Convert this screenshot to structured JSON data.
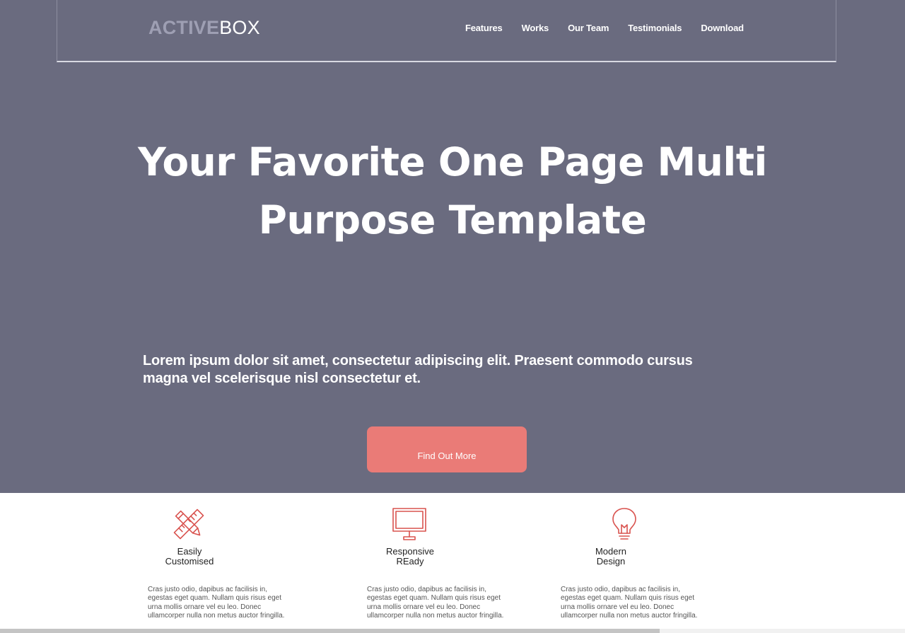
{
  "brand": {
    "logo_bold": "ACTIVE",
    "logo_light": "BOX"
  },
  "nav": {
    "items": [
      {
        "label": "Features"
      },
      {
        "label": "Works"
      },
      {
        "label": "Our Team"
      },
      {
        "label": "Testimonials"
      },
      {
        "label": "Download"
      }
    ]
  },
  "hero": {
    "headline_line1": "Your Favorite One Page Multi",
    "headline_line2": "Purpose Template",
    "lead": "Lorem ipsum dolor sit amet, consectetur adipiscing elit. Praesent commodo cursus magna vel scelerisque nisl consectetur et.",
    "cta_label": "Find Out More"
  },
  "features": [
    {
      "icon": "pencil-ruler-icon",
      "title_line1": "Easily",
      "title_line2": "Customised",
      "body": "Cras justo odio, dapibus ac facilisis in, egestas eget quam. Nullam quis risus eget urna mollis ornare vel eu leo. Donec ullamcorper nulla non metus auctor fringilla."
    },
    {
      "icon": "monitor-icon",
      "title_line1": "Responsive",
      "title_line2": "REady",
      "body": "Cras justo odio, dapibus ac facilisis in, egestas eget quam. Nullam quis risus eget urna mollis ornare vel eu leo. Donec ullamcorper nulla non metus auctor fringilla."
    },
    {
      "icon": "lightbulb-icon",
      "title_line1": "Modern",
      "title_line2": "Design",
      "body": "Cras justo odio, dapibus ac facilisis in, egestas eget quam. Nullam quis risus eget urna mollis ornare vel eu leo. Donec ullamcorper nulla non metus auctor fringilla."
    }
  ],
  "colors": {
    "hero_background": "#6a6b7f",
    "accent": "#ea7b77",
    "logo_bold": "#9e9fb3",
    "text_light": "#ffffff"
  }
}
